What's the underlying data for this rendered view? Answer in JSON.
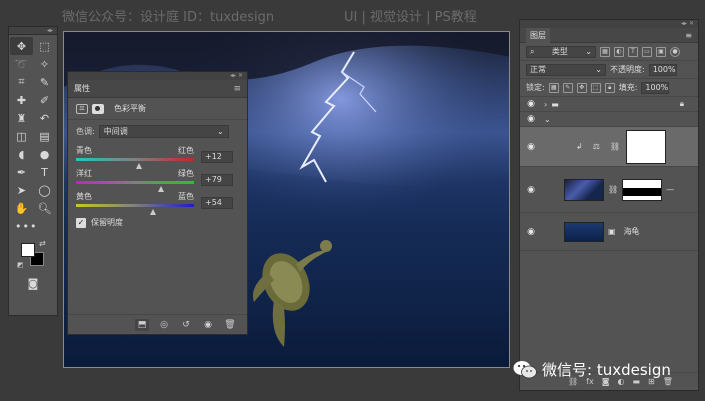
{
  "watermarks": {
    "top_left": "微信公众号：设计庭  ID：tuxdesign",
    "top_right": "UI | 视觉设计 | PS教程",
    "bottom": "微信号: tuxdesign"
  },
  "toolbar": {
    "tools": [
      "move-tool-icon",
      "marquee-tool-icon",
      "lasso-tool-icon",
      "magic-wand-icon",
      "crop-tool-icon",
      "eyedropper-icon",
      "healing-brush-icon",
      "brush-tool-icon",
      "clone-stamp-icon",
      "history-brush-icon",
      "eraser-icon",
      "gradient-tool-icon",
      "blur-tool-icon",
      "dodge-tool-icon",
      "pen-tool-icon",
      "type-tool-icon",
      "path-select-icon",
      "shape-tool-icon",
      "hand-tool-icon",
      "zoom-tool-icon"
    ],
    "type_glyph": "T",
    "more_glyph": "•••",
    "foreground_color": "#ffffff",
    "background_color": "#000000"
  },
  "properties": {
    "title": "属性",
    "adjustment_name": "色彩平衡",
    "tone_label": "色调:",
    "tone_value": "中间调",
    "sliders": [
      {
        "left": "青色",
        "right": "红色",
        "value": "+12",
        "position": 0.53
      },
      {
        "left": "洋红",
        "right": "绿色",
        "value": "+79",
        "position": 0.72
      },
      {
        "left": "黄色",
        "right": "蓝色",
        "value": "+54",
        "position": 0.65
      }
    ],
    "preserve_label": "保留明度",
    "preserve_checked": true
  },
  "layers": {
    "tab_label": "图层",
    "filter_label": "类型",
    "blend_mode": "正常",
    "opacity_label": "不透明度:",
    "opacity_value": "100%",
    "lock_label": "锁定:",
    "fill_label": "填充:",
    "fill_value": "100%",
    "items": [
      {
        "name": "海龟"
      }
    ],
    "footer_fx": "fx"
  }
}
